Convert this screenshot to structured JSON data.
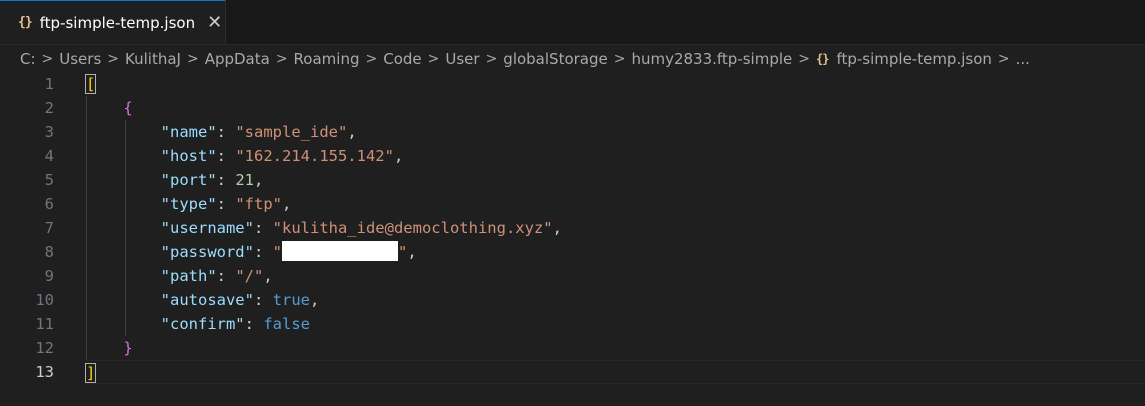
{
  "tab": {
    "icon": "{}",
    "title": "ftp-simple-temp.json",
    "close": "✕"
  },
  "breadcrumb": {
    "items": [
      "C:",
      "Users",
      "KulithaJ",
      "AppData",
      "Roaming",
      "Code",
      "User",
      "globalStorage",
      "humy2833.ftp-simple"
    ],
    "file_icon": "{}",
    "file": "ftp-simple-temp.json",
    "more": "..."
  },
  "editor": {
    "line_numbers": [
      "1",
      "2",
      "3",
      "4",
      "5",
      "6",
      "7",
      "8",
      "9",
      "10",
      "11",
      "12",
      "13"
    ],
    "open_array": "[",
    "open_obj": "{",
    "close_obj": "}",
    "close_array": "]",
    "entries": [
      {
        "key": "\"name\"",
        "value": "\"sample_ide\"",
        "type": "string",
        "comma": ","
      },
      {
        "key": "\"host\"",
        "value": "\"162.214.155.142\"",
        "type": "string",
        "comma": ","
      },
      {
        "key": "\"port\"",
        "value": "21",
        "type": "number",
        "comma": ","
      },
      {
        "key": "\"type\"",
        "value": "\"ftp\"",
        "type": "string",
        "comma": ","
      },
      {
        "key": "\"username\"",
        "value": "\"kulitha_ide@democlothing.xyz\"",
        "type": "string",
        "comma": ","
      },
      {
        "key": "\"password\"",
        "value_open": "\"",
        "value_close": "\"",
        "type": "redacted",
        "comma": ","
      },
      {
        "key": "\"path\"",
        "value": "\"/\"",
        "type": "string",
        "comma": ","
      },
      {
        "key": "\"autosave\"",
        "value": "true",
        "type": "bool",
        "comma": ","
      },
      {
        "key": "\"confirm\"",
        "value": "false",
        "type": "bool",
        "comma": ""
      }
    ]
  }
}
